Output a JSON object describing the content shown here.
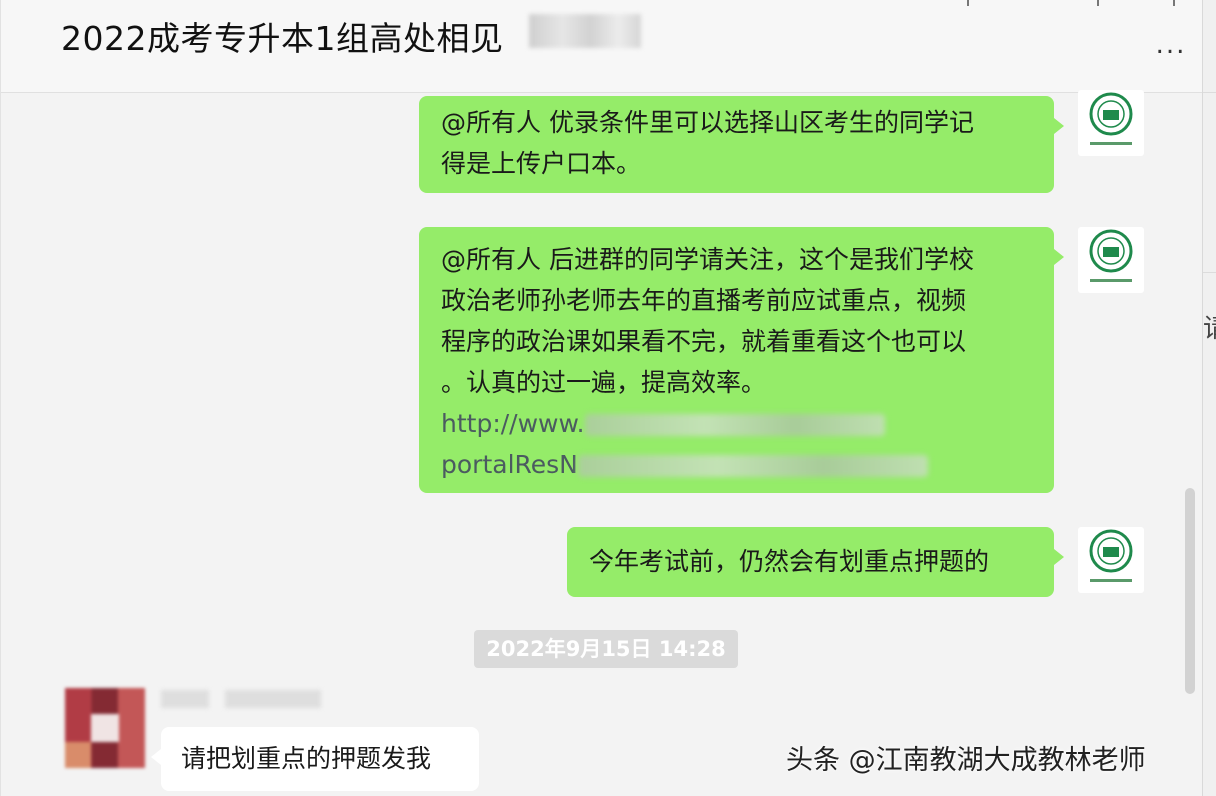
{
  "header": {
    "title": "2022成考专升本1组高处相见",
    "more_label": "..."
  },
  "messages": [
    {
      "sender": "self",
      "lines": [
        "@所有人 优录条件里可以选择山区考生的同学记",
        "得是上传户口本。"
      ]
    },
    {
      "sender": "self",
      "lines": [
        "@所有人 后进群的同学请关注，这个是我们学校",
        "政治老师孙老师去年的直播考前应试重点，视频",
        "程序的政治课如果看不完，就着重看这个也可以",
        "。认真的过一遍，提高效率。"
      ],
      "link_lines": [
        "http://www.",
        "portalResN"
      ]
    },
    {
      "sender": "self",
      "lines": [
        "今年考试前，仍然会有划重点押题的"
      ]
    }
  ],
  "timestamp": "2022年9月15日 14:28",
  "peer_message": {
    "text": "请把划重点的押题发我"
  },
  "right_pane": {
    "char": "请"
  },
  "watermark": "头条 @江南教湖大成教林老师",
  "colors": {
    "bubble_self": "#95ec69",
    "bubble_peer": "#ffffff",
    "background": "#f3f3f3",
    "avatar_logo": "#1f8a4c"
  }
}
